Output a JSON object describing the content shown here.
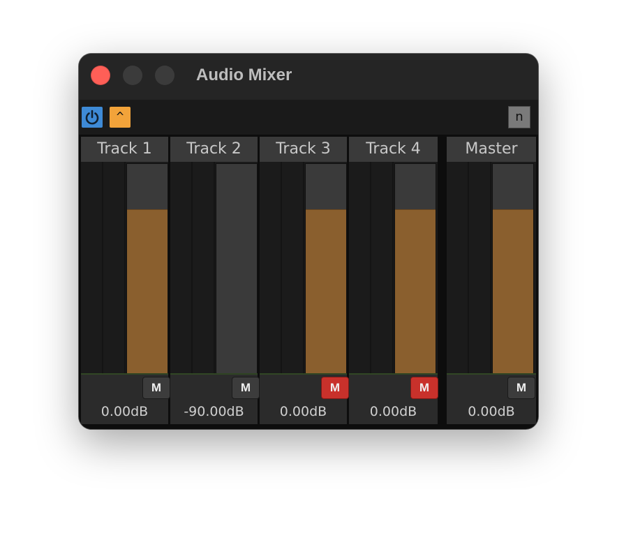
{
  "window": {
    "title": "Audio Mixer",
    "traffic_lights": [
      "close",
      "minimize",
      "maximize"
    ]
  },
  "toolbar": {
    "power_icon": "power-icon",
    "caret_label": "^",
    "n_label": "n",
    "colors": {
      "power": "#3e8ad6",
      "caret": "#f2a33a",
      "n": "#7a7a7a"
    }
  },
  "strips": [
    {
      "name": "Track 1",
      "mute_label": "M",
      "muted": false,
      "gain": "0.00dB",
      "fader_level": 0.78
    },
    {
      "name": "Track 2",
      "mute_label": "M",
      "muted": false,
      "gain": "-90.00dB",
      "fader_level": 0.0
    },
    {
      "name": "Track 3",
      "mute_label": "M",
      "muted": true,
      "gain": "0.00dB",
      "fader_level": 0.78
    },
    {
      "name": "Track 4",
      "mute_label": "M",
      "muted": true,
      "gain": "0.00dB",
      "fader_level": 0.78
    }
  ],
  "master": {
    "name": "Master",
    "mute_label": "M",
    "muted": false,
    "gain": "0.00dB",
    "fader_level": 0.78
  },
  "colors": {
    "fader_fill": "#8a5f2e",
    "mute_on": "#c8312b",
    "mute_off": "#3c3c3c"
  }
}
